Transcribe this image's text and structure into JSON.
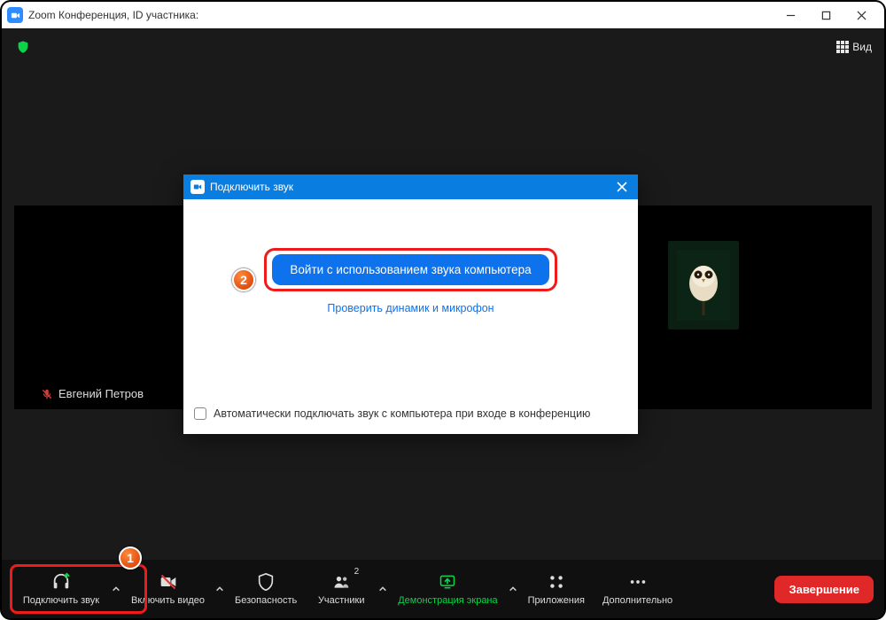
{
  "window": {
    "title": "Zoom Конференция, ID участника:"
  },
  "top": {
    "view_label": "Вид"
  },
  "participant": {
    "name": "Евгений Петров"
  },
  "modal": {
    "title": "Подключить звук",
    "join_button": "Войти с использованием звука компьютера",
    "test_link": "Проверить динамик и микрофон",
    "auto_connect_label": "Автоматически подключать звук с компьютера при входе в конференцию"
  },
  "controls": {
    "audio": "Подключить звук",
    "video": "Включить видео",
    "security": "Безопасность",
    "participants": "Участники",
    "participants_count": "2",
    "share": "Демонстрация экрана",
    "apps": "Приложения",
    "more": "Дополнительно",
    "end": "Завершение"
  },
  "annotations": {
    "step1": "1",
    "step2": "2"
  }
}
